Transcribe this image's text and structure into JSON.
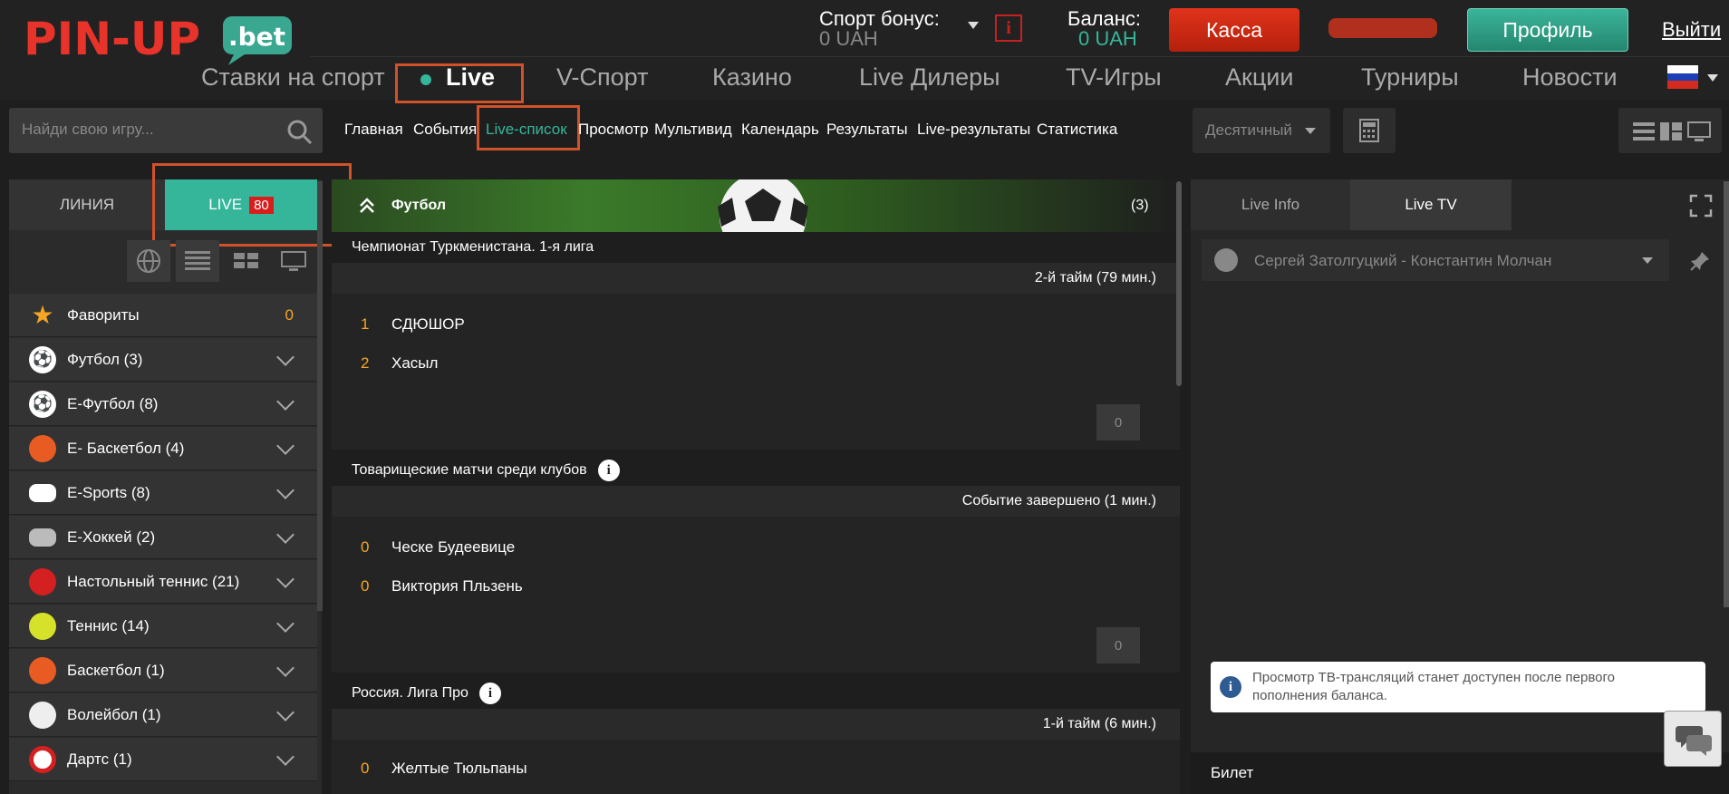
{
  "header": {
    "logo_text": "PIN-UP",
    "logo_suffix": ".bet",
    "sport_bonus_label": "Спорт бонус:",
    "sport_bonus_value": "0 UAH",
    "balance_label": "Баланс:",
    "balance_value": "0 UAH",
    "kassa_label": "Касса",
    "profile_label": "Профиль",
    "exit_label": "Выйти",
    "info_icon": "info-square-icon"
  },
  "nav": {
    "items": [
      "Ставки на спорт",
      "Live",
      "V-Спорт",
      "Казино",
      "Live Дилеры",
      "TV-Игры",
      "Акции",
      "Турниры",
      "Новости"
    ],
    "active": "Live"
  },
  "subnav": {
    "search_placeholder": "Найди свою игру...",
    "links": [
      "Главная",
      "События",
      "Live-список",
      "Просмотр",
      "Мультивид",
      "Календарь",
      "Результаты",
      "Live-результаты",
      "Статистика"
    ],
    "active": "Live-список",
    "odds_format": "Десятичный"
  },
  "left": {
    "tab_line": "ЛИНИЯ",
    "tab_live": "LIVE",
    "live_count": "80",
    "sports": [
      {
        "label": "Фавориты",
        "icon": "star-icon",
        "count": "0"
      },
      {
        "label": "Футбол (3)",
        "icon": "soccer-ball-icon"
      },
      {
        "label": "E-Футбол (8)",
        "icon": "esoccer-icon"
      },
      {
        "label": "E- Баскетбол (4)",
        "icon": "ebasketball-icon"
      },
      {
        "label": "E-Sports (8)",
        "icon": "gamepad-icon"
      },
      {
        "label": "E-Хоккей (2)",
        "icon": "ehockey-icon"
      },
      {
        "label": "Настольный теннис (21)",
        "icon": "table-tennis-icon"
      },
      {
        "label": "Теннис (14)",
        "icon": "tennis-ball-icon"
      },
      {
        "label": "Баскетбол (1)",
        "icon": "basketball-icon"
      },
      {
        "label": "Волейбол (1)",
        "icon": "volleyball-icon"
      },
      {
        "label": "Дартс (1)",
        "icon": "darts-icon"
      }
    ]
  },
  "center": {
    "sport_title": "Футбол",
    "sport_count": "(3)",
    "events": [
      {
        "league": "Чемпионат Туркменистана. 1-я лига",
        "status": "2-й тайм  (79 мин.)",
        "team1_score": "1",
        "team1": "СДЮШОР",
        "team2_score": "2",
        "team2": "Хасыл",
        "odd": "0"
      },
      {
        "league": "Товарищеские матчи среди клубов",
        "status": "Событие завершено  (1 мин.)",
        "team1_score": "0",
        "team1": "Ческе Будеевице",
        "team2_score": "0",
        "team2": "Виктория Пльзень",
        "odd": "0"
      },
      {
        "league": "Россия. Лига Про",
        "status": "1-й тайм  (6 мин.)",
        "team1_score": "0",
        "team1": "Желтые Тюльпаны"
      }
    ]
  },
  "right": {
    "tab_info": "Live Info",
    "tab_tv": "Live TV",
    "match": "Сергей Затолгуцкий - Константин Молчан",
    "notice": "Просмотр ТВ-трансляций станет доступен после первого пополнения баланса.",
    "bilet": "Билет"
  },
  "colors": {
    "accent": "#35b69a",
    "kassa": "#d42a14",
    "highlight": "#d0512a",
    "score": "#f5a623"
  }
}
